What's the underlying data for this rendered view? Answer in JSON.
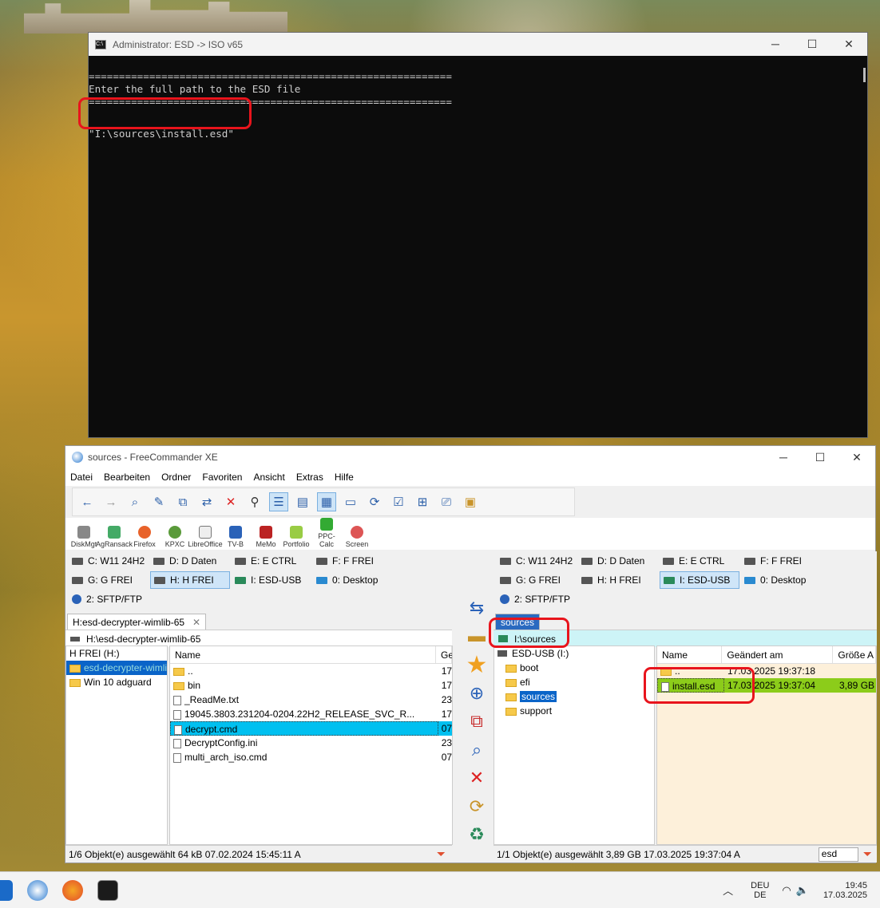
{
  "console": {
    "title": "Administrator:  ESD -> ISO v65",
    "lines": [
      "============================================================",
      "Enter the full path to the ESD file",
      "============================================================",
      "",
      "\"I:\\sources\\install.esd\""
    ],
    "minimize": "─",
    "maximize": "☐",
    "close": "✕"
  },
  "fc": {
    "title": "sources - FreeCommander XE",
    "minimize": "─",
    "maximize": "☐",
    "close": "✕",
    "menu": [
      "Datei",
      "Bearbeiten",
      "Ordner",
      "Favoriten",
      "Ansicht",
      "Extras",
      "Hilfe"
    ],
    "apps": [
      "DiskMgt",
      "AgRansack",
      "Firefox",
      "KPXC",
      "LibreOffice",
      "TV-B",
      "MeMo",
      "Portfolio",
      "PPC-Calc",
      "Screen"
    ],
    "left": {
      "drives": [
        "C: W11 24H2",
        "D: D Daten",
        "E: E CTRL",
        "F: F FREI",
        "G: G FREI",
        "H: H FREI",
        "I: ESD-USB",
        "0: Desktop",
        "2: SFTP/FTP"
      ],
      "tab": "H:esd-decrypter-wimlib-65",
      "tab_close": "✕",
      "path": "H:\\esd-decrypter-wimlib-65",
      "tree": [
        "H FREI (H:)",
        "esd-decrypter-wimlib",
        "Win 10 adguard"
      ],
      "hdr_name": "Name",
      "hdr_g": "Ge",
      "rows": [
        {
          "n": "..",
          "d": "17"
        },
        {
          "n": "bin",
          "d": "17"
        },
        {
          "n": "_ReadMe.txt",
          "d": "23"
        },
        {
          "n": "19045.3803.231204-0204.22H2_RELEASE_SVC_R...",
          "d": "17"
        },
        {
          "n": "decrypt.cmd",
          "d": "07"
        },
        {
          "n": "DecryptConfig.ini",
          "d": "23"
        },
        {
          "n": "multi_arch_iso.cmd",
          "d": "07"
        }
      ],
      "status": "1/6 Objekt(e) ausgewählt    64 kB    07.02.2024  15:45:11    A"
    },
    "right": {
      "drives": [
        "C: W11 24H2",
        "D: D Daten",
        "E: E CTRL",
        "F: F FREI",
        "G: G FREI",
        "H: H FREI",
        "I: ESD-USB",
        "0: Desktop",
        "2: SFTP/FTP"
      ],
      "tab": "sources",
      "path": "I:\\sources",
      "tree": [
        "ESD-USB (I:)",
        "boot",
        "efi",
        "sources",
        "support"
      ],
      "hdr": [
        "Name",
        "Geändert am",
        "Größe A"
      ],
      "rows": [
        {
          "n": "..",
          "d": "17.03.2025 19:37:18",
          "s": ""
        },
        {
          "n": "install.esd",
          "d": "17.03.2025 19:37:04",
          "s": "3,89 GB"
        }
      ],
      "status": "1/1 Objekt(e) ausgewählt    3,89 GB    17.03.2025  19:37:04    A",
      "filter": "esd"
    }
  },
  "taskbar": {
    "lang1": "DEU",
    "lang2": "DE",
    "time": "19:45",
    "date": "17.03.2025"
  }
}
